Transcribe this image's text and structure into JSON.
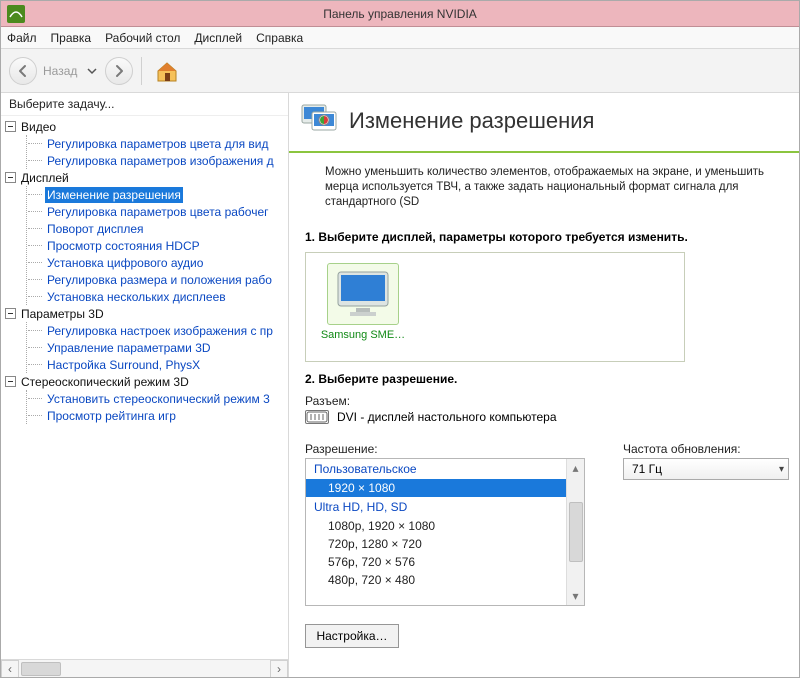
{
  "window": {
    "title": "Панель управления NVIDIA"
  },
  "menu": {
    "items": [
      "Файл",
      "Правка",
      "Рабочий стол",
      "Дисплей",
      "Справка"
    ]
  },
  "toolbar": {
    "back_label": "Назад"
  },
  "sidebar": {
    "title": "Выберите задачу...",
    "groups": [
      {
        "label": "Видео",
        "items": [
          {
            "label": "Регулировка параметров цвета для вид"
          },
          {
            "label": "Регулировка параметров изображения д"
          }
        ]
      },
      {
        "label": "Дисплей",
        "items": [
          {
            "label": "Изменение разрешения",
            "selected": true
          },
          {
            "label": "Регулировка параметров цвета рабочег"
          },
          {
            "label": "Поворот дисплея"
          },
          {
            "label": "Просмотр состояния HDCP"
          },
          {
            "label": "Установка цифрового аудио"
          },
          {
            "label": "Регулировка размера и положения рабо"
          },
          {
            "label": "Установка нескольких дисплеев"
          }
        ]
      },
      {
        "label": "Параметры 3D",
        "items": [
          {
            "label": "Регулировка настроек изображения с пр"
          },
          {
            "label": "Управление параметрами 3D"
          },
          {
            "label": "Настройка Surround, PhysX"
          }
        ]
      },
      {
        "label": "Стереоскопический режим 3D",
        "items": [
          {
            "label": "Установить стереоскопический режим 3"
          },
          {
            "label": "Просмотр рейтинга игр"
          }
        ]
      }
    ]
  },
  "content": {
    "title": "Изменение разрешения",
    "description": "Можно уменьшить количество элементов, отображаемых на экране, и уменьшить мерца используется ТВЧ, а также задать национальный формат сигнала для стандартного (SD",
    "step1": "1. Выберите дисплей, параметры которого требуется изменить.",
    "display": {
      "name": "Samsung SME…"
    },
    "step2": "2. Выберите разрешение.",
    "connector": {
      "label": "Разъем:",
      "value": "DVI - дисплей настольного компьютера"
    },
    "resolution": {
      "label": "Разрешение:",
      "groups": [
        {
          "group": "Пользовательское",
          "items": [
            {
              "label": "1920 × 1080",
              "selected": true
            }
          ]
        },
        {
          "group": "Ultra HD, HD, SD",
          "items": [
            {
              "label": "1080p, 1920 × 1080"
            },
            {
              "label": "720p, 1280 × 720"
            },
            {
              "label": "576p, 720 × 576"
            },
            {
              "label": "480p, 720 × 480"
            }
          ]
        }
      ]
    },
    "refresh": {
      "label": "Частота обновления:",
      "value": "71 Гц"
    },
    "customize_button": "Настройка…"
  }
}
